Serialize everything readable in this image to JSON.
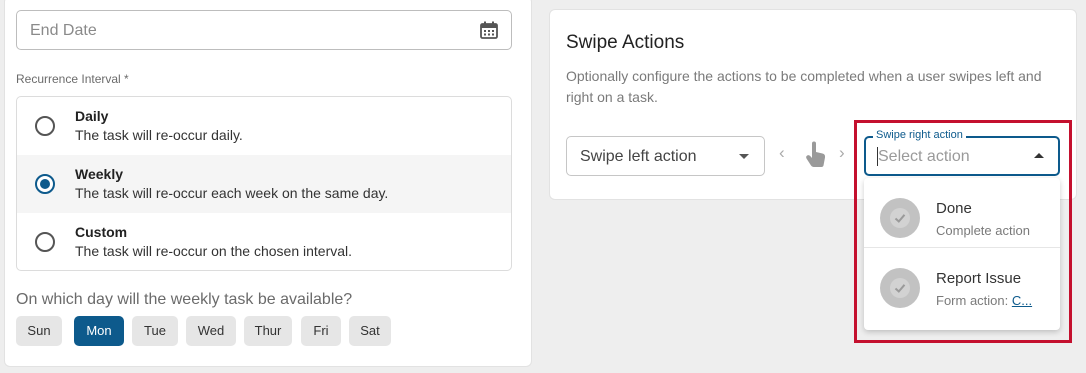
{
  "end_date": {
    "placeholder": "End Date",
    "icon": "calendar-icon"
  },
  "recurrence": {
    "label": "Recurrence Interval *",
    "options": [
      {
        "title": "Daily",
        "desc": "The task will re-occur daily.",
        "selected": false
      },
      {
        "title": "Weekly",
        "desc": "The task will re-occur each week on the same day.",
        "selected": true
      },
      {
        "title": "Custom",
        "desc": "The task will re-occur on the chosen interval.",
        "selected": false
      }
    ]
  },
  "weekday": {
    "question": "On which day will the weekly task be available?",
    "days": [
      "Sun",
      "Mon",
      "Tue",
      "Wed",
      "Thur",
      "Fri",
      "Sat"
    ],
    "selected": "Mon"
  },
  "swipe": {
    "title": "Swipe Actions",
    "description": "Optionally configure the actions to be completed when a user swipes left and right on a task.",
    "left_select": {
      "value": "Swipe left action"
    },
    "right_select": {
      "label": "Swipe right action",
      "placeholder": "Select action"
    },
    "dropdown_options": [
      {
        "title": "Done",
        "subtitle": "Complete action",
        "link": ""
      },
      {
        "title": "Report Issue",
        "subtitle": "Form action: ",
        "link": "C..."
      }
    ]
  },
  "colors": {
    "accent": "#0d5a8c",
    "highlight": "#c4102e"
  }
}
